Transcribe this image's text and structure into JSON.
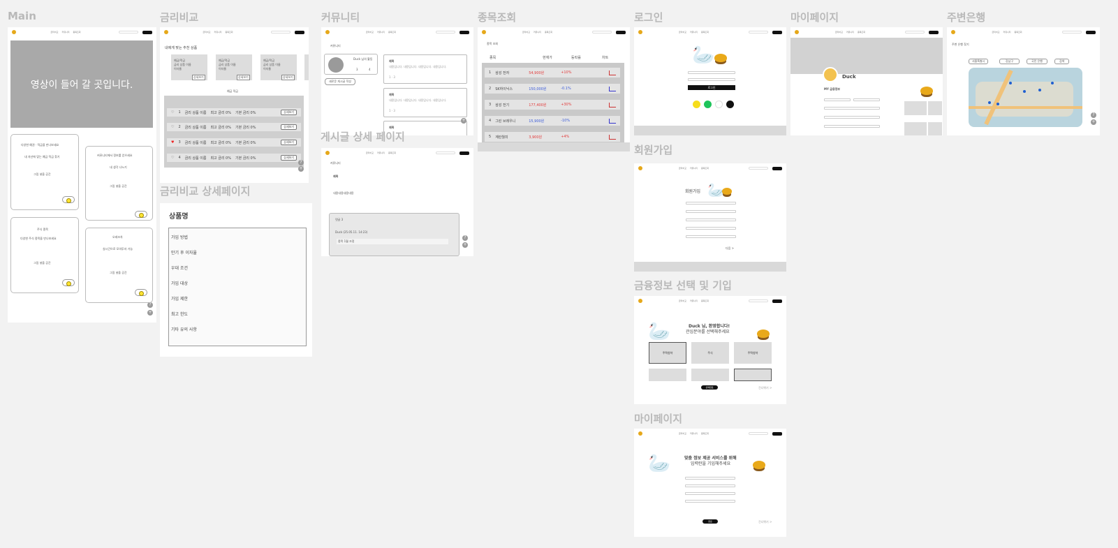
{
  "frames": {
    "main": {
      "label": "Main",
      "video": "영상이 들어 갈 곳입니다.",
      "cards": [
        {
          "t1": "다양한 예권 · 적금을 만나보세요",
          "t2": "내 자산에 맞는 예금 적금 찾기",
          "img": "그림 넣을 공간"
        },
        {
          "t1": "커뮤니티에서 정보를 얻으세요",
          "t2": "내 생각 나누기",
          "img": "그림 넣을 공간"
        },
        {
          "t1": "주식 종목",
          "t2": "다양한 주식 종목을 만나보세요",
          "img": "그림 넣을 공간"
        },
        {
          "t1": "오레조차",
          "t2": "실시간으로 모의투자 가능",
          "img": "그림 넣을 공간"
        }
      ]
    },
    "rate": {
      "label": "금리비교",
      "sub": "내에게 맞는 추천 상품",
      "products": [
        {
          "l1": "예금/적금",
          "l2": "금리 상품 이름",
          "l3": "이자율"
        },
        {
          "l1": "예금/적금",
          "l2": "금리 상품 이름",
          "l3": "이자율"
        },
        {
          "l1": "예금/적금",
          "l2": "금리 상품 이름",
          "l3": "이자율"
        }
      ],
      "detail_btn": "상세보기",
      "toggle": "예금 적금",
      "rows": [
        {
          "n": "1",
          "name": "금리 상품 이름",
          "max": "최고 금리 0%",
          "base": "기본 금리 0%",
          "heart": "♡"
        },
        {
          "n": "2",
          "name": "금리 상품 이름",
          "max": "최고 금리 0%",
          "base": "기본 금리 0%",
          "heart": "♡"
        },
        {
          "n": "3",
          "name": "금리 상품 이름",
          "max": "최고 금리 0%",
          "base": "기본 금리 0%",
          "heart": "♥"
        },
        {
          "n": "4",
          "name": "금리 상품 이름",
          "max": "최고 금리 0%",
          "base": "기본 금리 0%",
          "heart": "♡"
        }
      ]
    },
    "rate_detail": {
      "label": "금리비교 상세페이지",
      "title": "상품명",
      "items": [
        "가입 방법",
        "만기 후 이자율",
        "우대 조건",
        "가입 대상",
        "가입 제한",
        "최고 한도",
        "기타 유의 사항"
      ]
    },
    "community": {
      "label": "커뮤니티",
      "title": "커뮤니티",
      "user": "Duck 님의 활동",
      "stats": [
        "3",
        "4"
      ],
      "new_post": "새로운 게시글 작성",
      "posts": [
        {
          "title": "제목",
          "body": "내용입니다. 내용입니다. 내용입니다. 내용입니다.",
          "meta": "1 · 3"
        },
        {
          "title": "제목",
          "body": "내용입니다. 내용입니다. 내용입니다. 내용입니다.",
          "meta": "1 · 3"
        },
        {
          "title": "제목",
          "body": "",
          "meta": ""
        }
      ]
    },
    "post_detail": {
      "label": "게시글 상세 페이지",
      "crumb": "커뮤니티",
      "title": "제목",
      "body": "내용내용내용내용",
      "comments": "댓글 3",
      "c_author": "Duck (25.05.11. 14:23)",
      "c_text": "종목 1월 조정"
    },
    "stocks": {
      "label": "종목조회",
      "crumb": "종목 조회",
      "headers": [
        "종목",
        "현재가",
        "등락률",
        "차트"
      ],
      "rows": [
        {
          "n": "1",
          "name": "삼성 전자",
          "price": "54,900원",
          "rate": "+10%",
          "color": "#e23b3b"
        },
        {
          "n": "2",
          "name": "SK하이닉스",
          "price": "150,000원",
          "rate": "-0.1%",
          "color": "#3a5bd9"
        },
        {
          "n": "3",
          "name": "삼성 전기",
          "price": "177,400원",
          "rate": "+30%",
          "color": "#e23b3b"
        },
        {
          "n": "4",
          "name": "그린 브레우니",
          "price": "15,900원",
          "rate": "-10%",
          "color": "#3a5bd9"
        },
        {
          "n": "5",
          "name": "계란월미",
          "price": "3,900원",
          "rate": "+4%",
          "color": "#e23b3b"
        }
      ]
    },
    "login": {
      "label": "로그인",
      "login_btn": "로그인"
    },
    "signup": {
      "label": "회원가입",
      "title": "회원가입",
      "next": "다음 >"
    },
    "finance": {
      "label": "금융정보 선택 및 기입",
      "greet1": "Duck 님, 환영합니다!",
      "greet2": "관심분야를 선택해주세요",
      "options": [
        "주택청약",
        "주식",
        "주택청약",
        "",
        "",
        ""
      ],
      "next": "선택완료",
      "skip": "건너뛰기 >"
    },
    "mypage": {
      "label": "마이페이지",
      "name": "Duck",
      "section": "MY 금융정보"
    },
    "mypage2": {
      "label": "마이페이지",
      "t1": "맞춤 정보 제공 서비스를 위해",
      "t2": "입력란을 기입해주세요",
      "btn": "완료",
      "skip": "건너뛰기 >"
    },
    "bank": {
      "label": "주변은행",
      "title": "주변 은행 찾기",
      "f1": "서울특별시",
      "f2": "강남구",
      "f3": "국민 은행",
      "search": "검색"
    }
  }
}
